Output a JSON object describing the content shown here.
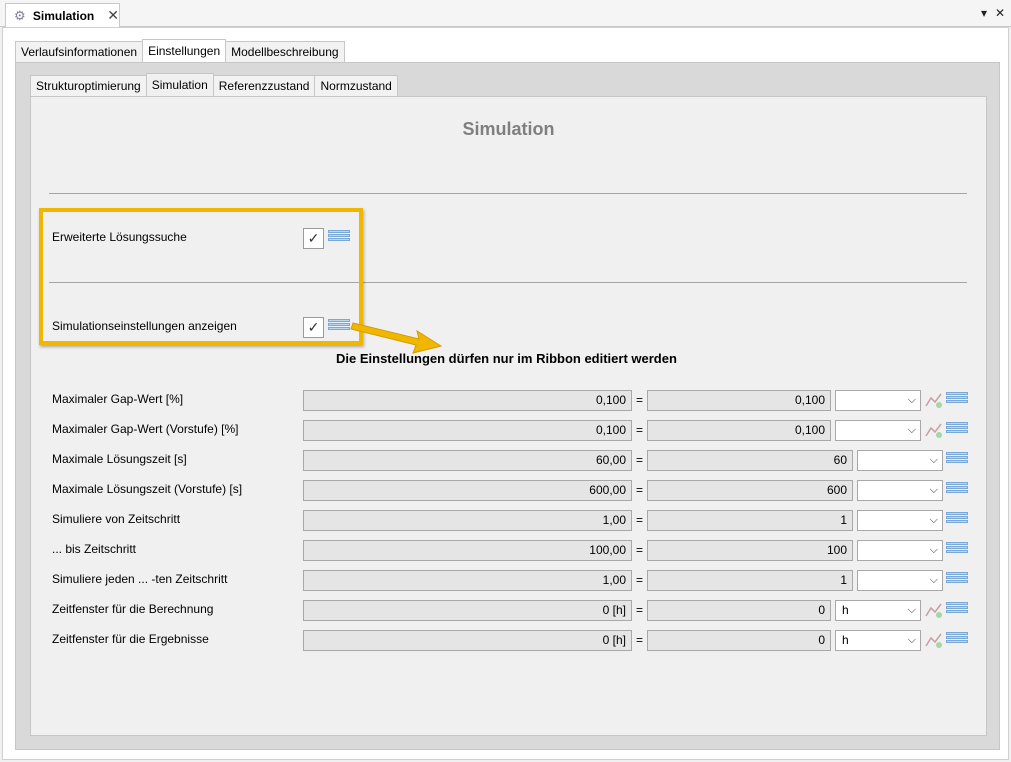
{
  "window": {
    "tab_title": "Simulation",
    "close_glyph": "✕",
    "dropdown_glyph": "▾",
    "close_window_glyph": "✕"
  },
  "outer_tabs": [
    {
      "label": "Verlaufsinformationen",
      "active": false
    },
    {
      "label": "Einstellungen",
      "active": true
    },
    {
      "label": "Modellbeschreibung",
      "active": false
    }
  ],
  "inner_tabs": [
    {
      "label": "Strukturoptimierung",
      "active": false
    },
    {
      "label": "Simulation",
      "active": true
    },
    {
      "label": "Referenzzustand",
      "active": false
    },
    {
      "label": "Normzustand",
      "active": false
    }
  ],
  "page": {
    "title": "Simulation",
    "note": "Die Einstellungen dürfen nur im Ribbon editiert werden"
  },
  "checkboxes": [
    {
      "label": "Erweiterte Lösungssuche",
      "checked": true
    },
    {
      "label": "Simulationseinstellungen anzeigen",
      "checked": true
    }
  ],
  "rows": [
    {
      "label": "Maximaler Gap-Wert [%]",
      "value": "0,100",
      "value2": "0,100",
      "unit": "",
      "chart": true
    },
    {
      "label": "Maximaler Gap-Wert (Vorstufe) [%]",
      "value": "0,100",
      "value2": "0,100",
      "unit": "",
      "chart": true
    },
    {
      "label": "Maximale Lösungszeit [s]",
      "value": "60,00",
      "value2": "60",
      "unit": "",
      "chart": false
    },
    {
      "label": "Maximale Lösungszeit (Vorstufe) [s]",
      "value": "600,00",
      "value2": "600",
      "unit": "",
      "chart": false
    },
    {
      "label": "Simuliere von Zeitschritt",
      "value": "1,00",
      "value2": "1",
      "unit": "",
      "chart": false
    },
    {
      "label": "... bis Zeitschritt",
      "value": "100,00",
      "value2": "100",
      "unit": "",
      "chart": false
    },
    {
      "label": "Simuliere jeden ... -ten Zeitschritt",
      "value": "1,00",
      "value2": "1",
      "unit": "",
      "chart": false
    },
    {
      "label": "Zeitfenster für die Berechnung",
      "value": "0 [h]",
      "value2": "0",
      "unit": "h",
      "chart": true
    },
    {
      "label": "Zeitfenster für die Ergebnisse",
      "value": "0 [h]",
      "value2": "0",
      "unit": "h",
      "chart": true
    }
  ],
  "colors": {
    "highlight": "#f1b700",
    "title_gray": "#7f7f7f"
  }
}
